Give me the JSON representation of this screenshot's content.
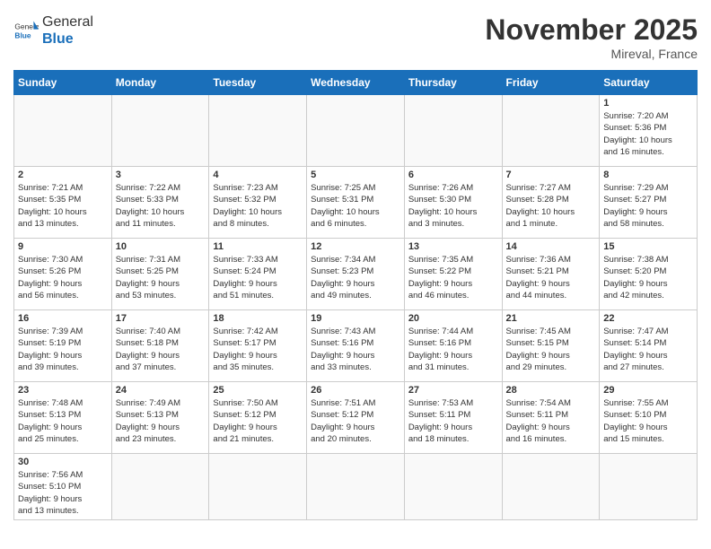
{
  "header": {
    "logo_general": "General",
    "logo_blue": "Blue",
    "month_title": "November 2025",
    "location": "Mireval, France"
  },
  "weekdays": [
    "Sunday",
    "Monday",
    "Tuesday",
    "Wednesday",
    "Thursday",
    "Friday",
    "Saturday"
  ],
  "weeks": [
    [
      {
        "day": "",
        "info": ""
      },
      {
        "day": "",
        "info": ""
      },
      {
        "day": "",
        "info": ""
      },
      {
        "day": "",
        "info": ""
      },
      {
        "day": "",
        "info": ""
      },
      {
        "day": "",
        "info": ""
      },
      {
        "day": "1",
        "info": "Sunrise: 7:20 AM\nSunset: 5:36 PM\nDaylight: 10 hours\nand 16 minutes."
      }
    ],
    [
      {
        "day": "2",
        "info": "Sunrise: 7:21 AM\nSunset: 5:35 PM\nDaylight: 10 hours\nand 13 minutes."
      },
      {
        "day": "3",
        "info": "Sunrise: 7:22 AM\nSunset: 5:33 PM\nDaylight: 10 hours\nand 11 minutes."
      },
      {
        "day": "4",
        "info": "Sunrise: 7:23 AM\nSunset: 5:32 PM\nDaylight: 10 hours\nand 8 minutes."
      },
      {
        "day": "5",
        "info": "Sunrise: 7:25 AM\nSunset: 5:31 PM\nDaylight: 10 hours\nand 6 minutes."
      },
      {
        "day": "6",
        "info": "Sunrise: 7:26 AM\nSunset: 5:30 PM\nDaylight: 10 hours\nand 3 minutes."
      },
      {
        "day": "7",
        "info": "Sunrise: 7:27 AM\nSunset: 5:28 PM\nDaylight: 10 hours\nand 1 minute."
      },
      {
        "day": "8",
        "info": "Sunrise: 7:29 AM\nSunset: 5:27 PM\nDaylight: 9 hours\nand 58 minutes."
      }
    ],
    [
      {
        "day": "9",
        "info": "Sunrise: 7:30 AM\nSunset: 5:26 PM\nDaylight: 9 hours\nand 56 minutes."
      },
      {
        "day": "10",
        "info": "Sunrise: 7:31 AM\nSunset: 5:25 PM\nDaylight: 9 hours\nand 53 minutes."
      },
      {
        "day": "11",
        "info": "Sunrise: 7:33 AM\nSunset: 5:24 PM\nDaylight: 9 hours\nand 51 minutes."
      },
      {
        "day": "12",
        "info": "Sunrise: 7:34 AM\nSunset: 5:23 PM\nDaylight: 9 hours\nand 49 minutes."
      },
      {
        "day": "13",
        "info": "Sunrise: 7:35 AM\nSunset: 5:22 PM\nDaylight: 9 hours\nand 46 minutes."
      },
      {
        "day": "14",
        "info": "Sunrise: 7:36 AM\nSunset: 5:21 PM\nDaylight: 9 hours\nand 44 minutes."
      },
      {
        "day": "15",
        "info": "Sunrise: 7:38 AM\nSunset: 5:20 PM\nDaylight: 9 hours\nand 42 minutes."
      }
    ],
    [
      {
        "day": "16",
        "info": "Sunrise: 7:39 AM\nSunset: 5:19 PM\nDaylight: 9 hours\nand 39 minutes."
      },
      {
        "day": "17",
        "info": "Sunrise: 7:40 AM\nSunset: 5:18 PM\nDaylight: 9 hours\nand 37 minutes."
      },
      {
        "day": "18",
        "info": "Sunrise: 7:42 AM\nSunset: 5:17 PM\nDaylight: 9 hours\nand 35 minutes."
      },
      {
        "day": "19",
        "info": "Sunrise: 7:43 AM\nSunset: 5:16 PM\nDaylight: 9 hours\nand 33 minutes."
      },
      {
        "day": "20",
        "info": "Sunrise: 7:44 AM\nSunset: 5:16 PM\nDaylight: 9 hours\nand 31 minutes."
      },
      {
        "day": "21",
        "info": "Sunrise: 7:45 AM\nSunset: 5:15 PM\nDaylight: 9 hours\nand 29 minutes."
      },
      {
        "day": "22",
        "info": "Sunrise: 7:47 AM\nSunset: 5:14 PM\nDaylight: 9 hours\nand 27 minutes."
      }
    ],
    [
      {
        "day": "23",
        "info": "Sunrise: 7:48 AM\nSunset: 5:13 PM\nDaylight: 9 hours\nand 25 minutes."
      },
      {
        "day": "24",
        "info": "Sunrise: 7:49 AM\nSunset: 5:13 PM\nDaylight: 9 hours\nand 23 minutes."
      },
      {
        "day": "25",
        "info": "Sunrise: 7:50 AM\nSunset: 5:12 PM\nDaylight: 9 hours\nand 21 minutes."
      },
      {
        "day": "26",
        "info": "Sunrise: 7:51 AM\nSunset: 5:12 PM\nDaylight: 9 hours\nand 20 minutes."
      },
      {
        "day": "27",
        "info": "Sunrise: 7:53 AM\nSunset: 5:11 PM\nDaylight: 9 hours\nand 18 minutes."
      },
      {
        "day": "28",
        "info": "Sunrise: 7:54 AM\nSunset: 5:11 PM\nDaylight: 9 hours\nand 16 minutes."
      },
      {
        "day": "29",
        "info": "Sunrise: 7:55 AM\nSunset: 5:10 PM\nDaylight: 9 hours\nand 15 minutes."
      }
    ],
    [
      {
        "day": "30",
        "info": "Sunrise: 7:56 AM\nSunset: 5:10 PM\nDaylight: 9 hours\nand 13 minutes."
      },
      {
        "day": "",
        "info": ""
      },
      {
        "day": "",
        "info": ""
      },
      {
        "day": "",
        "info": ""
      },
      {
        "day": "",
        "info": ""
      },
      {
        "day": "",
        "info": ""
      },
      {
        "day": "",
        "info": ""
      }
    ]
  ]
}
